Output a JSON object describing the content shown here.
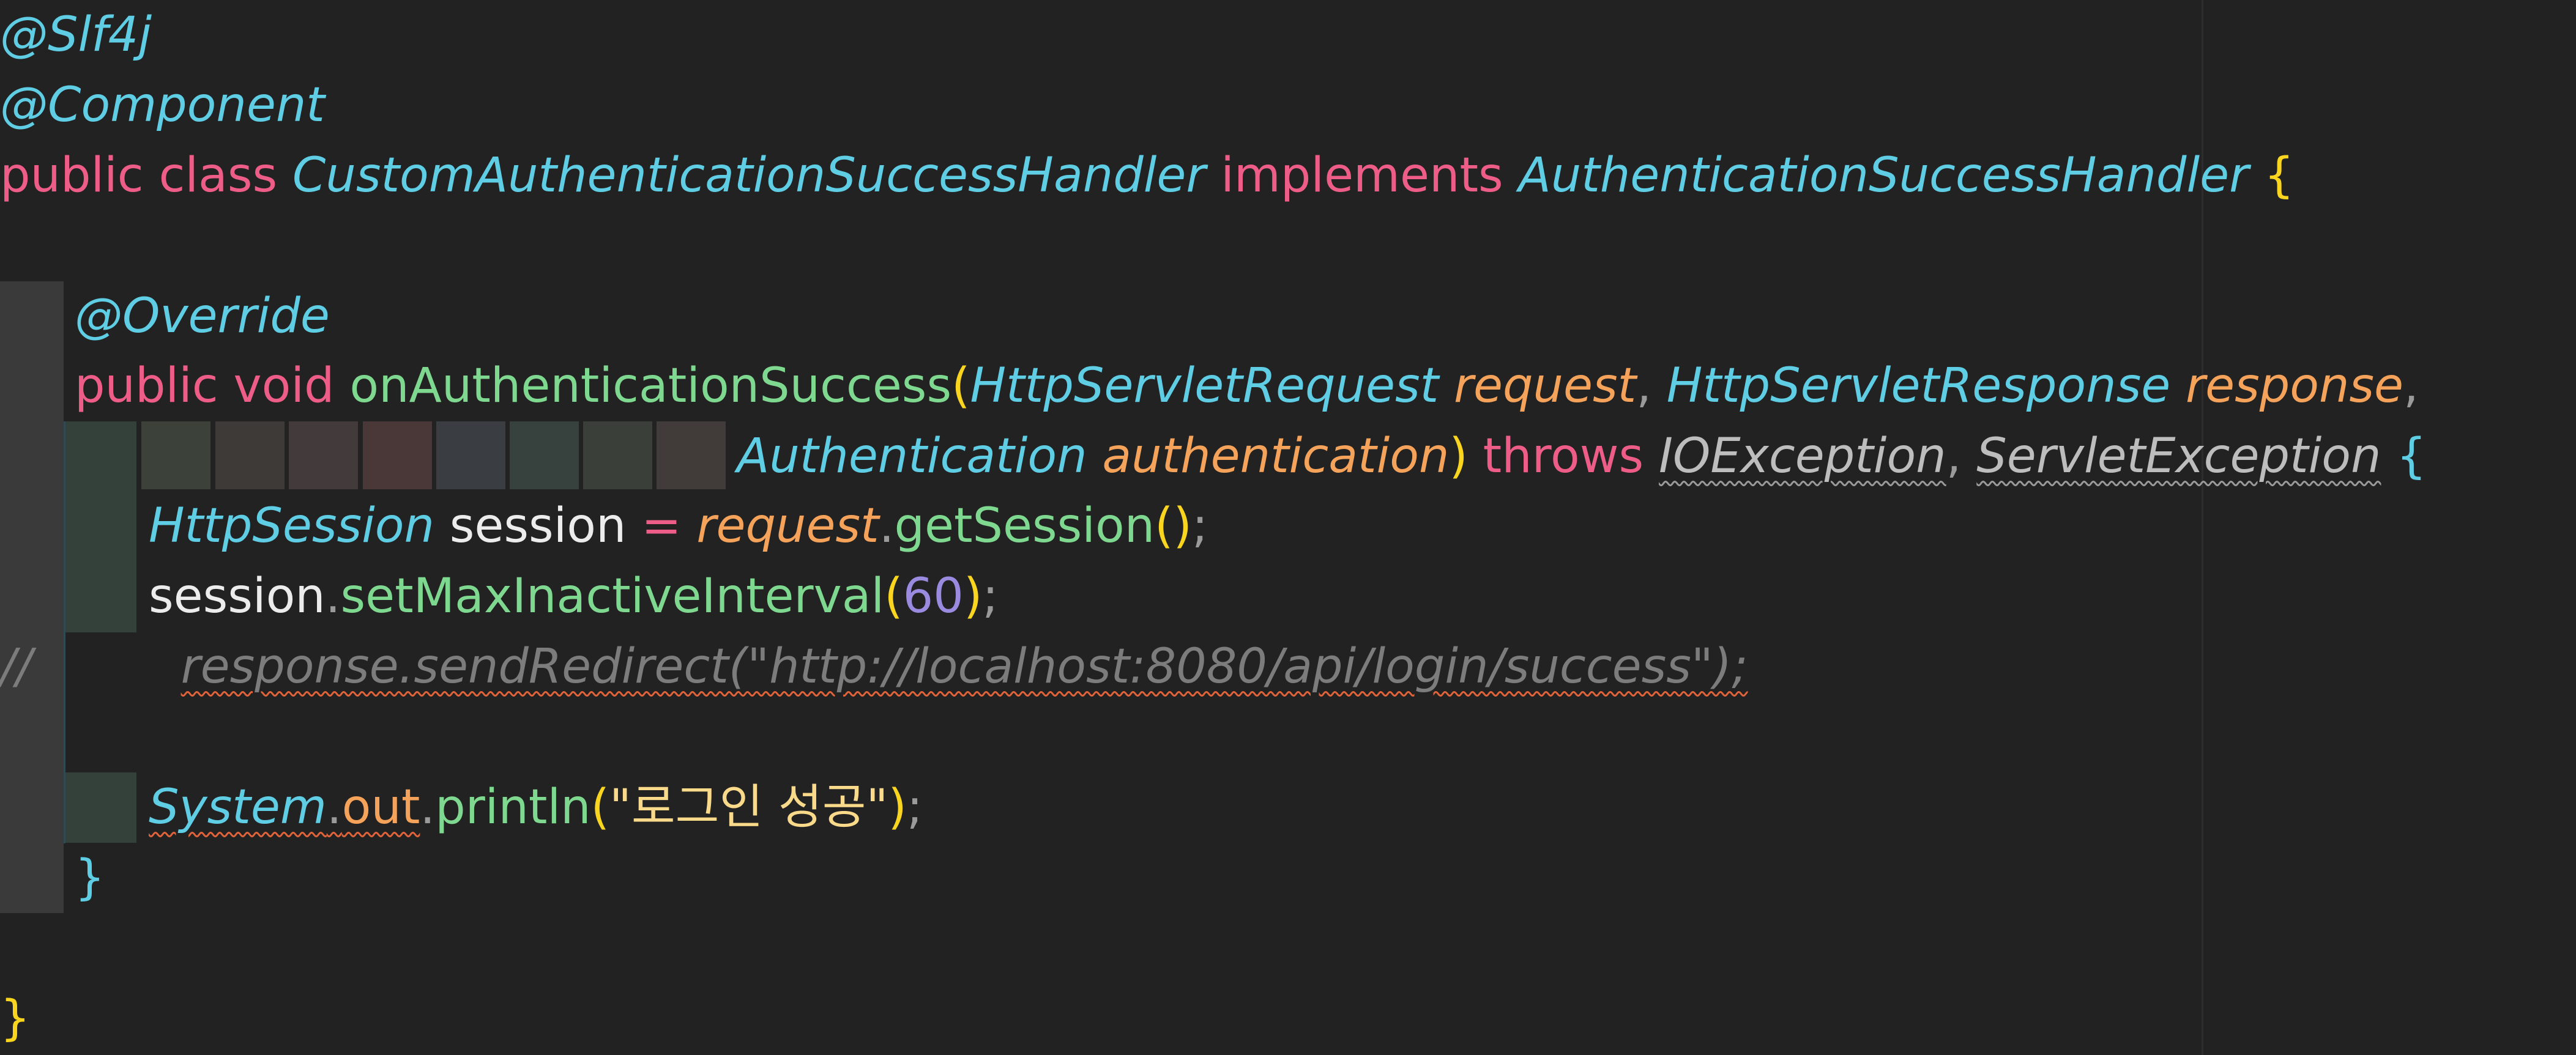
{
  "editor": {
    "lines": {
      "l1": {
        "annotation": "@Slf4j"
      },
      "l2": {
        "annotation": "@Component"
      },
      "l3": {
        "kw_public": "public",
        "kw_class": "class",
        "class_name": "CustomAuthenticationSuccessHandler",
        "kw_implements": "implements",
        "interface_name": "AuthenticationSuccessHandler",
        "open_brace": "{"
      },
      "l5": {
        "annotation": "@Override"
      },
      "l6": {
        "kw_public": "public",
        "kw_void": "void",
        "method_name": "onAuthenticationSuccess",
        "open_paren": "(",
        "type1": "HttpServletRequest",
        "param1": "request",
        "comma1": ",",
        "type2": "HttpServletResponse",
        "param2": "response",
        "comma2": ","
      },
      "l7": {
        "type3": "Authentication",
        "param3": "authentication",
        "close_paren": ")",
        "kw_throws": "throws",
        "ex1": "IOException",
        "comma": ",",
        "ex2": "ServletException",
        "open_brace": "{"
      },
      "l8": {
        "type": "HttpSession",
        "var": "session",
        "assign": "=",
        "obj": "request",
        "dot": ".",
        "call": "getSession",
        "parens": "()",
        "semi": ";"
      },
      "l9": {
        "var": "session",
        "dot": ".",
        "call": "setMaxInactiveInterval",
        "open_paren": "(",
        "arg": "60",
        "close_paren": ")",
        "semi": ";"
      },
      "l10": {
        "comment_marker": "//",
        "comment_text": "response.sendRedirect(\"http://localhost:8080/api/login/success\");"
      },
      "l12": {
        "cls": "System",
        "dot1": ".",
        "field": "out",
        "dot2": ".",
        "call": "println",
        "open_paren": "(",
        "string": "\"로그인 성공\"",
        "close_paren": ")",
        "semi": ";"
      },
      "l13": {
        "close_brace": "}"
      },
      "l15": {
        "close_brace": "}"
      }
    },
    "colors": {
      "background": "#222222",
      "keyword": "#ee5d88",
      "type": "#5fcde4",
      "method": "#7fd88f",
      "parameter": "#f5a35b",
      "paren": "#f9d51f",
      "number": "#9b8be0",
      "string": "#f9d98a",
      "comment": "#7c7c7c"
    }
  }
}
